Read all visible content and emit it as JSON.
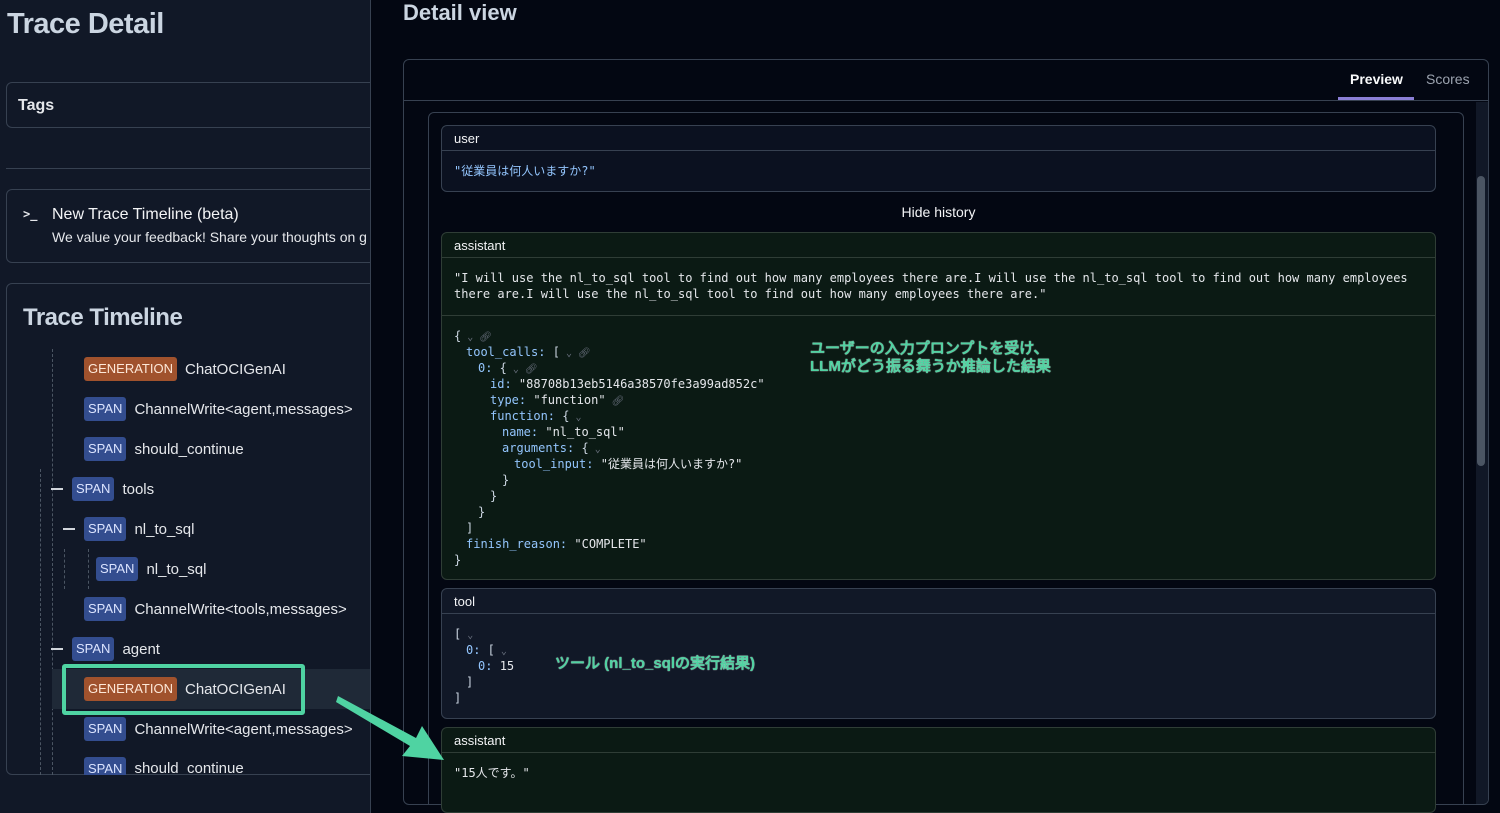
{
  "left": {
    "page_title": "Trace Detail",
    "tags_label": "Tags",
    "beta": {
      "icon": "terminal-prompt-icon",
      "prompt_glyph": ">_",
      "title": "New Trace Timeline (beta)",
      "subtitle": "We value your feedback! Share your thoughts on g"
    },
    "timeline": {
      "title": "Trace Timeline",
      "rows": [
        {
          "type": "GENERATION",
          "name": "ChatOCIGenAI"
        },
        {
          "type": "SPAN",
          "name": "ChannelWrite<agent,messages>"
        },
        {
          "type": "SPAN",
          "name": "should_continue"
        },
        {
          "type": "SPAN",
          "name": "tools"
        },
        {
          "type": "SPAN",
          "name": "nl_to_sql"
        },
        {
          "type": "SPAN",
          "name": "nl_to_sql"
        },
        {
          "type": "SPAN",
          "name": "ChannelWrite<tools,messages>"
        },
        {
          "type": "SPAN",
          "name": "agent"
        },
        {
          "type": "GENERATION",
          "name": "ChatOCIGenAI"
        },
        {
          "type": "SPAN",
          "name": "ChannelWrite<agent,messages>"
        },
        {
          "type": "SPAN",
          "name": "should_continue"
        }
      ]
    }
  },
  "right": {
    "title": "Detail view",
    "tabs": [
      "Preview",
      "Scores"
    ],
    "active_tab": "Preview",
    "hide_history": "Hide history",
    "messages": {
      "user": {
        "role": "user",
        "content": "\"従業員は何人いますか?\""
      },
      "assistant1": {
        "role": "assistant",
        "content_line1": "\"I will use the nl_to_sql tool to find out how many employees there are.I will use the nl_to_sql tool to find out how many employees",
        "content_line2": "there are.I will use the nl_to_sql tool to find out how many employees there are.\"",
        "json": {
          "tool_calls_key": "tool_calls:",
          "index_key": "0:",
          "id_key": "id:",
          "id_val": "\"88708b13eb5146a38570fe3a99ad852c\"",
          "type_key": "type:",
          "type_val": "\"function\"",
          "function_key": "function:",
          "name_key": "name:",
          "name_val": "\"nl_to_sql\"",
          "arguments_key": "arguments:",
          "tool_input_key": "tool_input:",
          "tool_input_val": "\"従業員は何人いますか?\"",
          "finish_reason_key": "finish_reason:",
          "finish_reason_val": "\"COMPLETE\""
        }
      },
      "tool": {
        "role": "tool",
        "index_outer": "0:",
        "index_inner": "0:",
        "value": "15"
      },
      "assistant2": {
        "role": "assistant",
        "content": "\"15人です。\""
      }
    },
    "annotations": {
      "assistant_note_line1": "ユーザーの入力プロンプトを受け、",
      "assistant_note_line2": "LLMがどう振る舞うか推論した結果",
      "tool_note": "ツール (nl_to_sqlの実行結果)"
    }
  },
  "colors": {
    "generation_badge": "#a0522d",
    "span_badge": "#334d8f",
    "highlight": "#4fd3a2",
    "tab_underline": "#8b7fd6"
  }
}
